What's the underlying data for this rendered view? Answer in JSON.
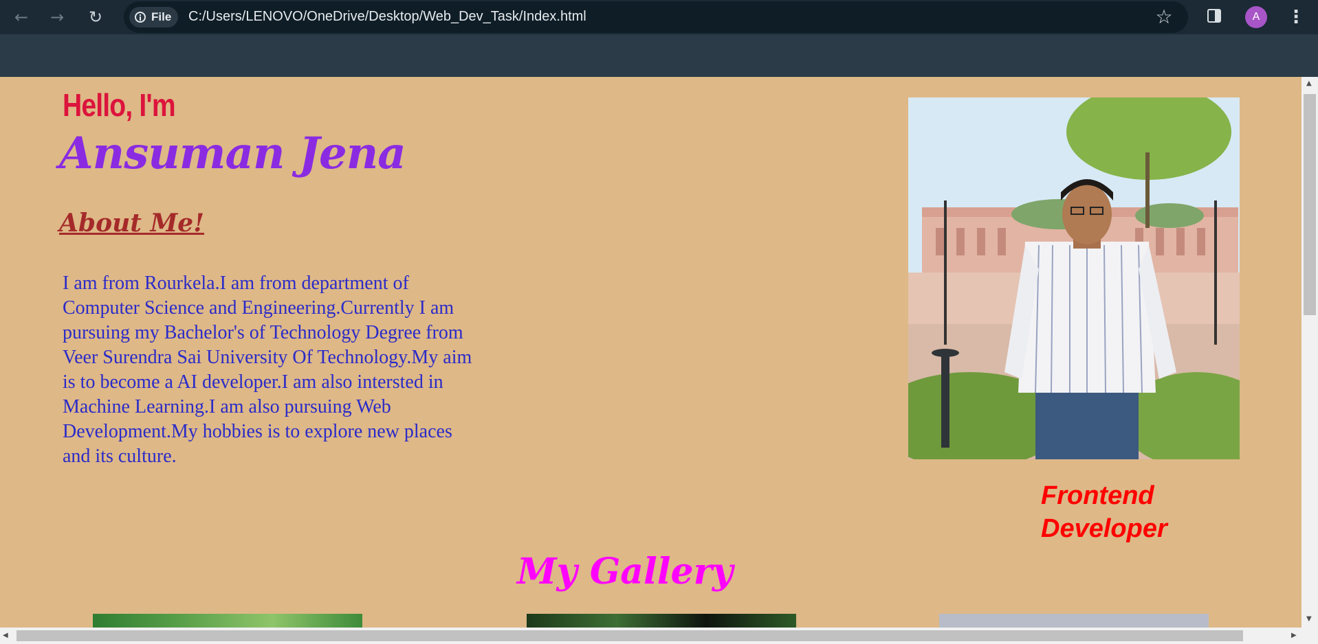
{
  "browser": {
    "back_icon": "arrow-left-icon",
    "forward_icon": "arrow-right-icon",
    "reload_icon": "reload-icon",
    "chip_label": "File",
    "url": "C:/Users/LENOVO/OneDrive/Desktop/Web_Dev_Task/Index.html",
    "avatar_initial": "A"
  },
  "intro": {
    "greeting": "Hello, I'm",
    "name": "Ansuman Jena"
  },
  "about": {
    "heading": "About Me!",
    "text": "I am from Rourkela.I am from department of Computer Science and Engineering.Currently I am pursuing my Bachelor's of Technology Degree from Veer Surendra Sai University Of Technology.My aim is to become a AI developer.I am also intersted in Machine Learning.I am also pursuing Web Development.My hobbies is to explore new places and its culture."
  },
  "profile": {
    "role": "Frontend Developer"
  },
  "gallery": {
    "title": "My Gallery"
  },
  "colors": {
    "page_bg": "#DEB887",
    "greeting": "#DC143C",
    "name": "#8A2BE2",
    "about_heading": "#A52A2A",
    "bio_text": "#2B2BC8",
    "role": "#FF0000",
    "gallery_title": "#FF00FF"
  }
}
